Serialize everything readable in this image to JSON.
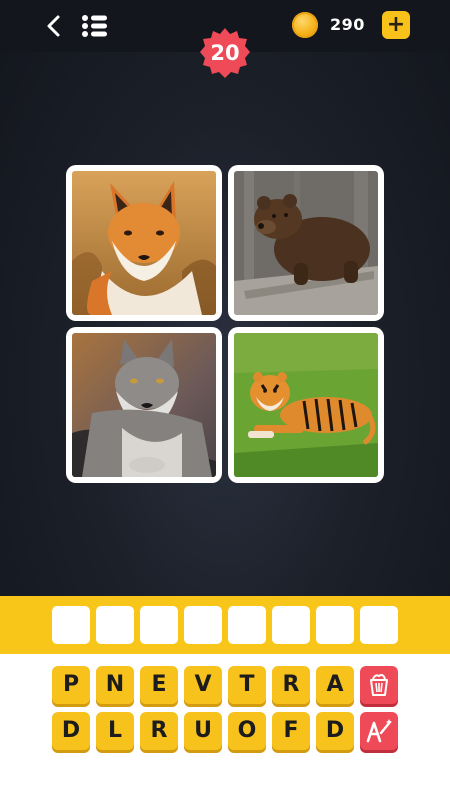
{
  "header": {
    "back_icon": "chevron-left-icon",
    "menu_icon": "list-icon",
    "coin_icon": "coin-icon",
    "coins": "290",
    "add_label": "+",
    "level": "20"
  },
  "puzzle": {
    "images": [
      "fox",
      "bear",
      "wolf",
      "tiger"
    ]
  },
  "answer": {
    "slots": [
      "",
      "",
      "",
      "",
      "",
      "",
      "",
      ""
    ]
  },
  "letters": {
    "row1": [
      "P",
      "N",
      "E",
      "V",
      "T",
      "R",
      "A"
    ],
    "row2": [
      "D",
      "L",
      "R",
      "U",
      "O",
      "F",
      "D"
    ]
  },
  "hints": {
    "remove_letters_icon": "trash-bucket-icon",
    "reveal_letter_icon": "magic-wand-letter-icon"
  },
  "colors": {
    "accent_yellow": "#f8c619",
    "badge_red": "#ef4a57",
    "background_dark": "#1c2029"
  }
}
